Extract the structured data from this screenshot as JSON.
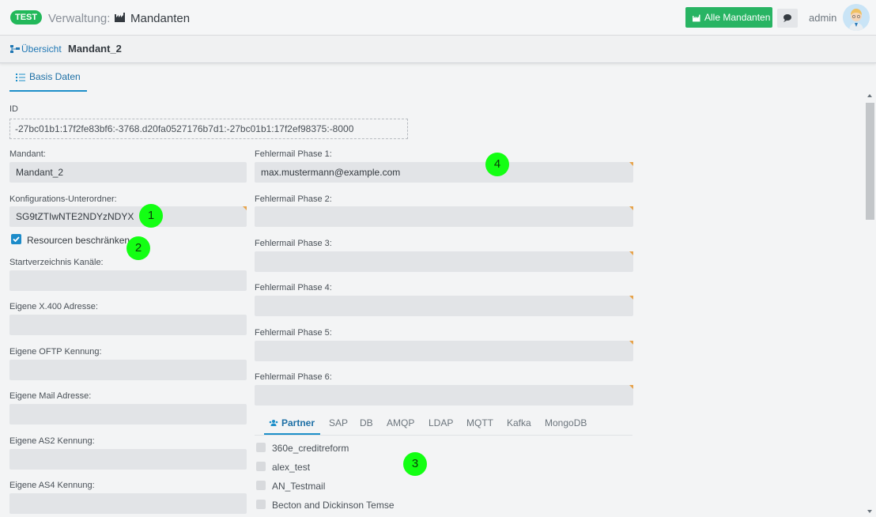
{
  "header": {
    "env_badge": "TEST",
    "app_label": "Verwaltung:",
    "page_title": "Mandanten",
    "all_button": "Alle Mandanten",
    "user": "admin",
    "accent": "#28b463"
  },
  "breadcrumb": {
    "overview": "Übersicht",
    "current": "Mandant_2"
  },
  "tabs": {
    "basis": "Basis Daten"
  },
  "id_field": {
    "label": "ID",
    "value": "-27bc01b1:17f2fe83bf6:-3768.d20fa0527176b7d1:-27bc01b1:17f2ef98375:-8000"
  },
  "left": {
    "mandant": {
      "label": "Mandant:",
      "value": "Mandant_2"
    },
    "konfig": {
      "label": "Konfigurations-Unterordner:",
      "value": "SG9tZTIwNTE2NDYzNDYX"
    },
    "resourcen": {
      "label": "Resourcen beschränken",
      "checked": true
    },
    "startverz": {
      "label": "Startverzeichnis Kanäle:",
      "value": ""
    },
    "x400": {
      "label": "Eigene X.400 Adresse:",
      "value": ""
    },
    "oftp": {
      "label": "Eigene OFTP Kennung:",
      "value": ""
    },
    "mail": {
      "label": "Eigene Mail Adresse:",
      "value": ""
    },
    "as2": {
      "label": "Eigene AS2 Kennung:",
      "value": ""
    },
    "as4": {
      "label": "Eigene AS4 Kennung:",
      "value": ""
    }
  },
  "right": {
    "phase1": {
      "label": "Fehlermail Phase 1:",
      "value": "max.mustermann@example.com"
    },
    "phase2": {
      "label": "Fehlermail Phase 2:",
      "value": ""
    },
    "phase3": {
      "label": "Fehlermail Phase 3:",
      "value": ""
    },
    "phase4": {
      "label": "Fehlermail Phase 4:",
      "value": ""
    },
    "phase5": {
      "label": "Fehlermail Phase 5:",
      "value": ""
    },
    "phase6": {
      "label": "Fehlermail Phase 6:",
      "value": ""
    }
  },
  "subtabs": [
    "Partner",
    "SAP",
    "DB",
    "AMQP",
    "LDAP",
    "MQTT",
    "Kafka",
    "MongoDB"
  ],
  "partners": [
    "360e_creditreform",
    "alex_test",
    "AN_Testmail",
    "Becton and Dickinson Temse"
  ],
  "markers": [
    "1",
    "2",
    "3",
    "4"
  ]
}
